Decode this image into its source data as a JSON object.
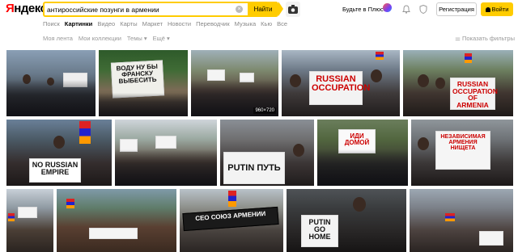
{
  "logo": {
    "first": "Я",
    "rest": "ндекс"
  },
  "search": {
    "query": "антироссийские позунги в армении",
    "button": "Найти"
  },
  "header": {
    "plus_link": "Будьте в Плюсе",
    "register": "Регистрация",
    "login": "Войти"
  },
  "tabs": [
    "Поиск",
    "Картинки",
    "Видео",
    "Карты",
    "Маркет",
    "Новости",
    "Переводчик",
    "Музыка",
    "Кью",
    "Все"
  ],
  "subnav": {
    "items": [
      "Моя лента",
      "Мои коллекции",
      "Темы ▾",
      "Ещё ▾"
    ],
    "filters": "Показать фильтры"
  },
  "images": {
    "r1_1": {
      "text": ""
    },
    "r1_2": {
      "text": "ВОДУ НУ БЫ ФРАНСКУ ВЫБЕСИТЬ"
    },
    "r1_3": {
      "text": "",
      "badge": "960×720"
    },
    "r1_4": {
      "text": "RUSSIAN OCCUPATION"
    },
    "r1_5": {
      "text": "RUSSIAN OCCUPATION OF ARMENIA"
    },
    "r2_2": {
      "text": "NO RUSSIAN EMPIRE"
    },
    "r2_4": {
      "text": "PUTIN ПУТЬ"
    },
    "r2_5": {
      "text": "ИДИ ДОМОЙ"
    },
    "r2_6": {
      "text": "НЕЗАВИСИМАЯ АРМЕНИЯ НИЩЕТА"
    },
    "r3_4": {
      "text": "CEO СОЮЗ АРМЕНИИ"
    },
    "r3_5": {
      "text": "PUTIN GO HOME"
    }
  },
  "colors": {
    "accent": "#ffcc00",
    "logo_red": "#ff0000"
  }
}
